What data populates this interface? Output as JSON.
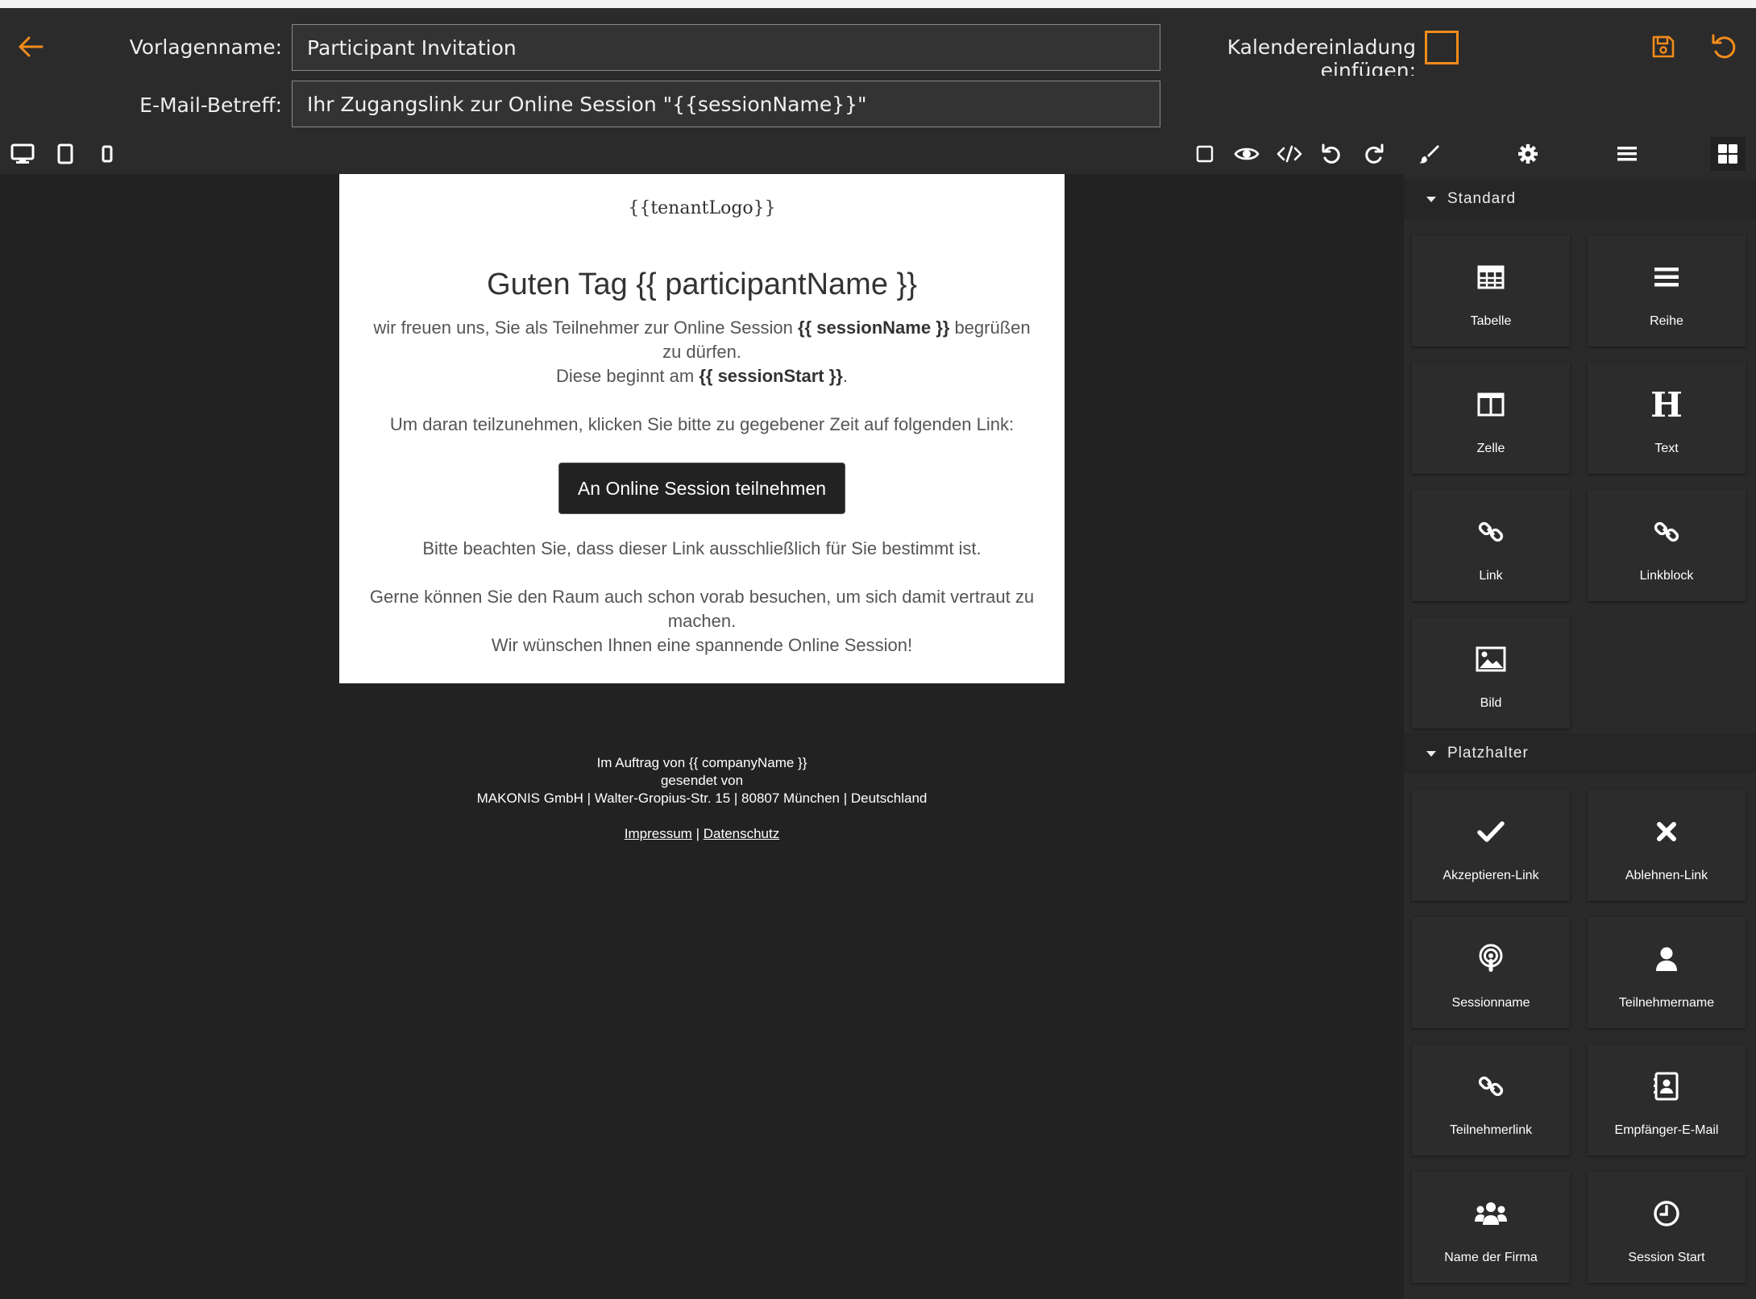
{
  "header": {
    "template_name_label": "Vorlagenname:",
    "template_name_value": "Participant Invitation",
    "calendar_label": "Kalendereinladung einfügen:",
    "subject_label": "E-Mail-Betreff:",
    "subject_value": "Ihr Zugangslink zur Online Session \"{{sessionName}}\""
  },
  "email": {
    "logo_placeholder": "{{tenantLogo}}",
    "greeting": "Guten Tag {{ participantName }}",
    "para1_a": "wir freuen uns, Sie als Teilnehmer zur Online Session ",
    "para1_b": "{{ sessionName }}",
    "para1_c": " begrüßen zu dürfen.",
    "para1_d": "Diese beginnt am ",
    "para1_e": "{{ sessionStart }}",
    "para1_f": ".",
    "para2": "Um daran teilzunehmen, klicken Sie bitte zu gegebener Zeit auf folgenden Link:",
    "cta_label": "An Online Session teilnehmen",
    "para3": "Bitte beachten Sie, dass dieser Link ausschließlich für Sie bestimmt ist.",
    "para4_a": "Gerne können Sie den Raum auch schon vorab besuchen, um sich damit vertraut zu machen.",
    "para4_b": "Wir wünschen Ihnen eine spannende Online Session!"
  },
  "footer": {
    "line1": "Im Auftrag von {{ companyName }}",
    "line2": "gesendet von",
    "line3": "MAKONIS GmbH | Walter-Gropius-Str. 15 | 80807 München | Deutschland",
    "impressum": "Impressum",
    "separator": "|",
    "datenschutz": "Datenschutz"
  },
  "panel": {
    "section_standard": "Standard",
    "section_placeholders": "Platzhalter",
    "standard_blocks": [
      {
        "label": "Tabelle",
        "icon": "table-icon"
      },
      {
        "label": "Reihe",
        "icon": "rows-icon"
      },
      {
        "label": "Zelle",
        "icon": "columns-icon"
      },
      {
        "label": "Text",
        "icon": "heading-icon"
      },
      {
        "label": "Link",
        "icon": "link-icon"
      },
      {
        "label": "Linkblock",
        "icon": "link-icon"
      },
      {
        "label": "Bild",
        "icon": "image-icon"
      }
    ],
    "placeholder_blocks": [
      {
        "label": "Akzeptieren-Link",
        "icon": "check-icon"
      },
      {
        "label": "Ablehnen-Link",
        "icon": "close-icon"
      },
      {
        "label": "Sessionname",
        "icon": "podcast-icon"
      },
      {
        "label": "Teilnehmername",
        "icon": "user-icon"
      },
      {
        "label": "Teilnehmerlink",
        "icon": "link-icon"
      },
      {
        "label": "Empfänger-E-Mail",
        "icon": "contact-icon"
      },
      {
        "label": "Name der Firma",
        "icon": "users-icon"
      },
      {
        "label": "Session Start",
        "icon": "clock-icon"
      }
    ]
  },
  "colors": {
    "accent": "#f28c1b",
    "background": "#222222",
    "panel": "#2a2a2a"
  }
}
